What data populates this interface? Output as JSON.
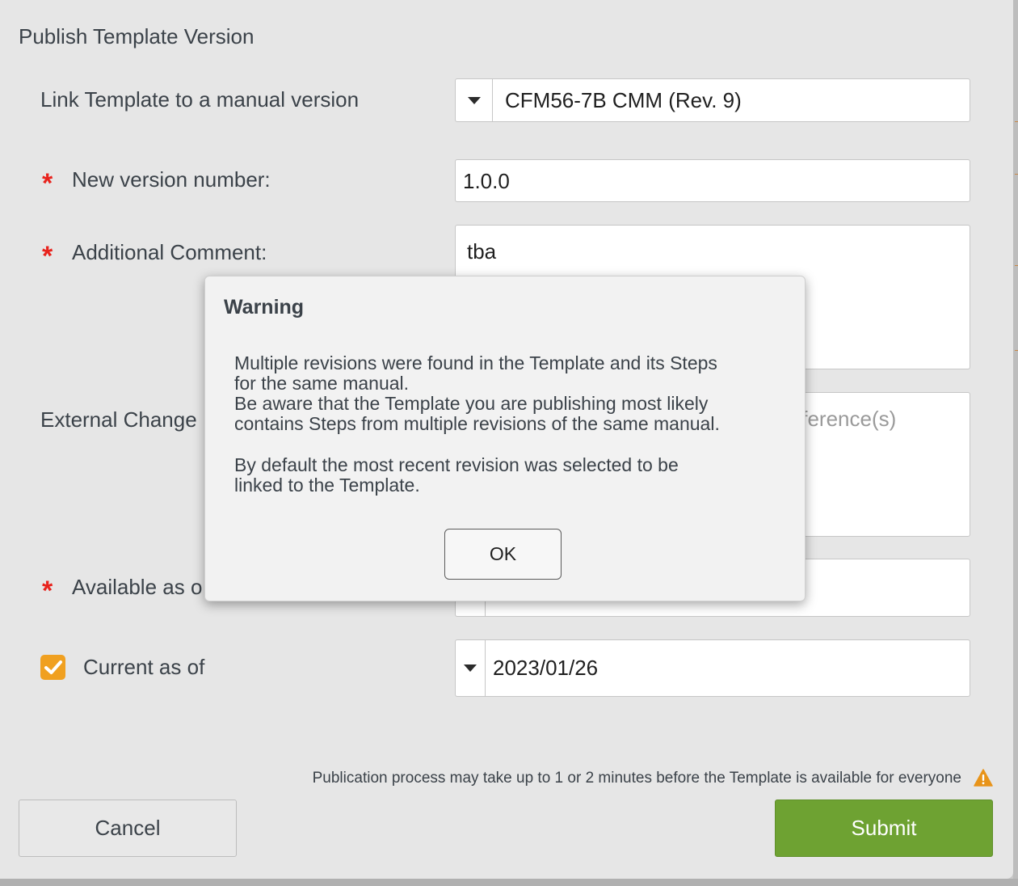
{
  "dialog": {
    "title": "Publish Template Version"
  },
  "form": {
    "manual_version": {
      "label": "Link Template to a manual version",
      "value": "CFM56-7B CMM (Rev. 9)"
    },
    "version_number": {
      "label": "New version number:",
      "value": "1.0.0"
    },
    "comment": {
      "label": "Additional Comment:",
      "value": "tba"
    },
    "external_change": {
      "label": "External Change",
      "placeholder": "Reference(s)"
    },
    "available_as": {
      "label": "Available as o"
    },
    "current_as_of": {
      "label": "Current as of",
      "checked": true,
      "value": "2023/01/26"
    },
    "required_marker": "*"
  },
  "footer": {
    "note": "Publication process may take up to 1 or 2 minutes before the Template is available for everyone",
    "cancel_label": "Cancel",
    "submit_label": "Submit"
  },
  "warning_modal": {
    "title": "Warning",
    "line1": "Multiple revisions were found in the Template and its Steps",
    "line2": "for the same manual.",
    "line3": "Be aware that the Template you are publishing most likely",
    "line4": "contains Steps from multiple revisions of the same manual.",
    "line5": "By default the most recent revision was selected to be",
    "line6": "linked to the Template.",
    "ok_label": "OK"
  },
  "colors": {
    "required": "#e8231d",
    "submit": "#6ea232",
    "checkbox": "#f0a020",
    "warning_icon": "#e8941a"
  },
  "icons": {
    "dropdown": "caret-down-icon",
    "check": "check-icon",
    "warning": "warning-triangle-icon"
  }
}
